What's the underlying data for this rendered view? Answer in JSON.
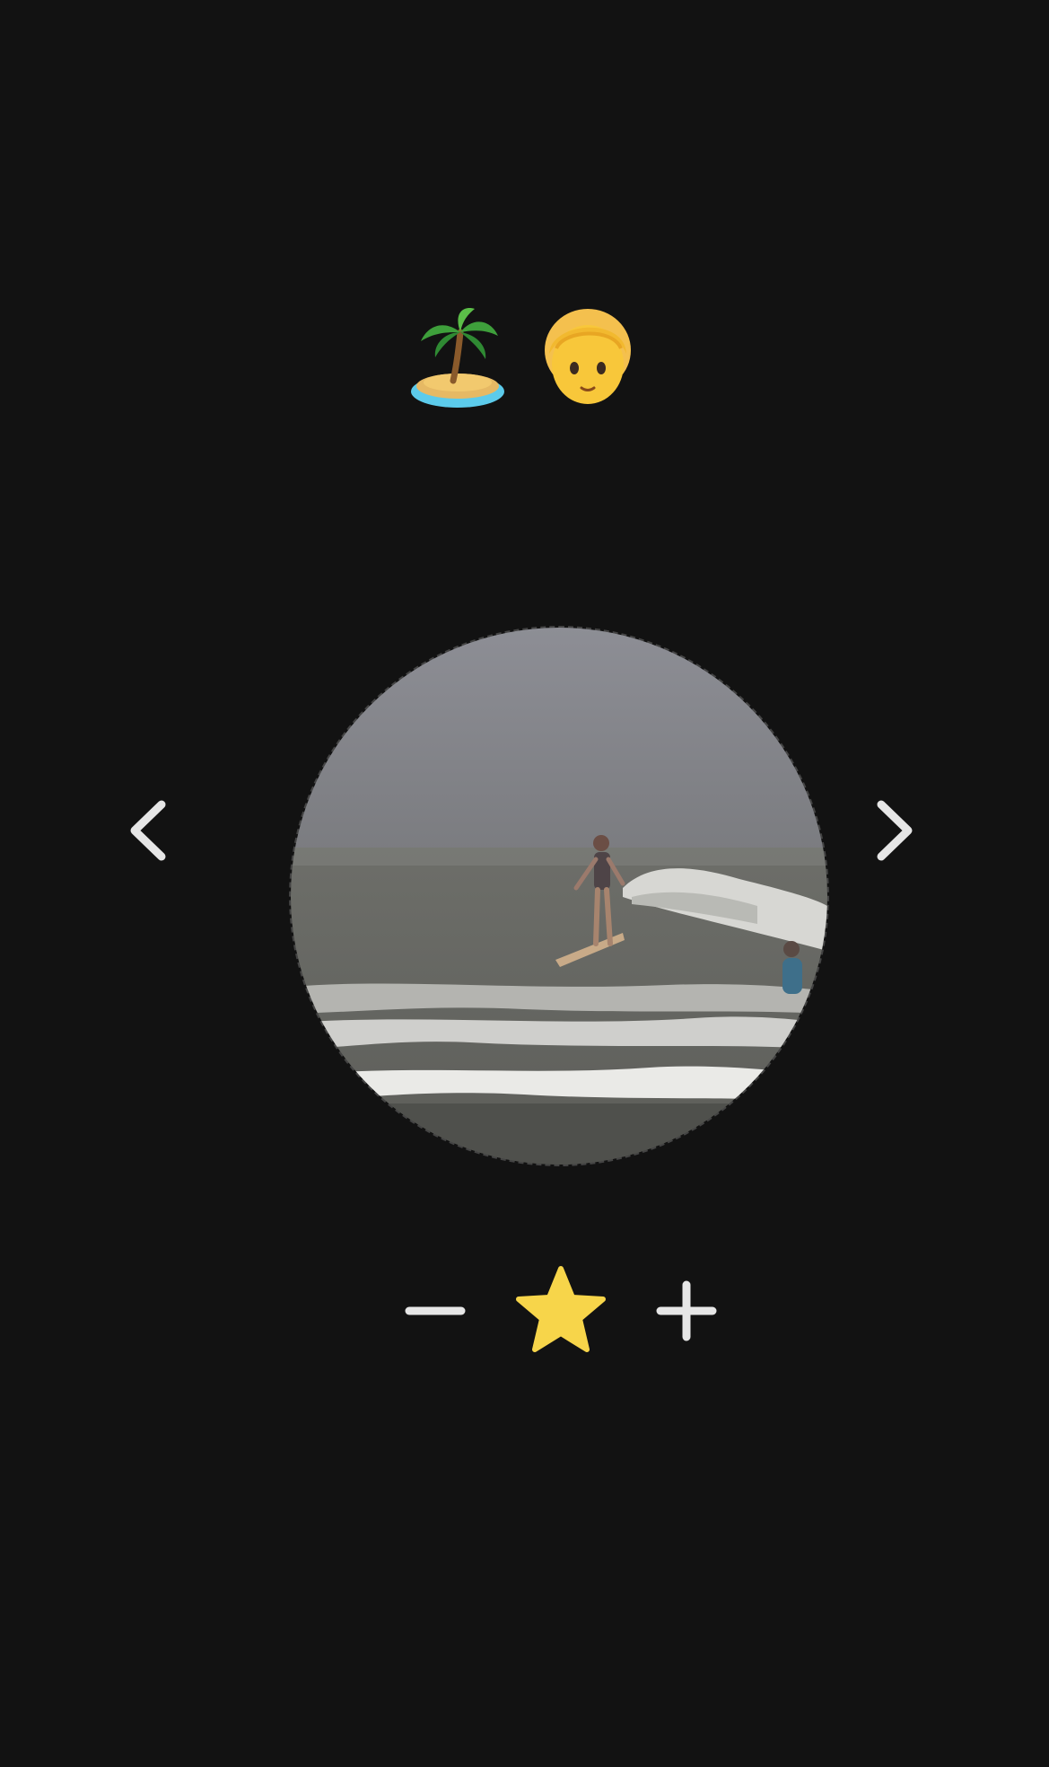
{
  "header": {
    "icons": [
      "palm-tree-island-emoji",
      "blond-person-emoji"
    ]
  },
  "viewer": {
    "image": "surfers-on-wave-photo",
    "prev_icon": "chevron-left-icon",
    "next_icon": "chevron-right-icon"
  },
  "rating_controls": {
    "icons": [
      "minus-icon",
      "star-icon",
      "plus-icon"
    ],
    "star_color": "#F7D54A",
    "icon_color": "#E6E6E6"
  },
  "colors": {
    "background": "#121212",
    "sky": "#8A8B90",
    "sea": "#6F706C",
    "foam": "#D9D9D6"
  }
}
